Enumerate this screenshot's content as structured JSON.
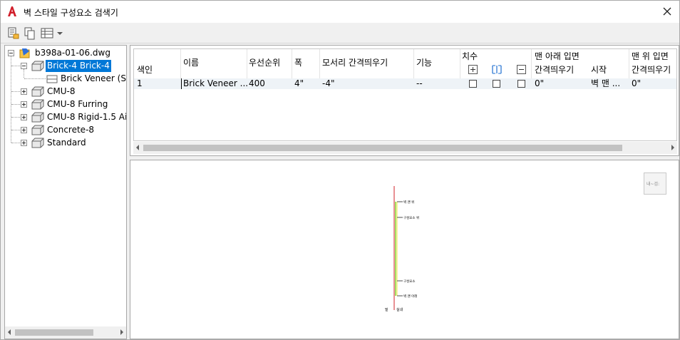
{
  "window": {
    "title": "벽 스타일 구성요소 검색기",
    "app_icon": "autocad-a-icon",
    "close_icon": "close-icon"
  },
  "toolbar": {
    "buttons": [
      {
        "name": "select-objects-button",
        "icon": "document-properties-icon"
      },
      {
        "name": "copy-button",
        "icon": "copy-icon"
      },
      {
        "name": "view-options-button",
        "icon": "table-view-icon"
      }
    ]
  },
  "tree": {
    "root": "b398a-01-06.dwg",
    "items": [
      {
        "label": "Brick-4 Brick-4",
        "expanded": true,
        "selected": true,
        "children": [
          {
            "label": "Brick Veneer (Str"
          }
        ]
      },
      {
        "label": "CMU-8",
        "expanded": false
      },
      {
        "label": "CMU-8 Furring",
        "expanded": false
      },
      {
        "label": "CMU-8 Rigid-1.5 Air",
        "expanded": false
      },
      {
        "label": "Concrete-8",
        "expanded": false
      },
      {
        "label": "Standard",
        "expanded": false
      }
    ]
  },
  "grid": {
    "headers": {
      "index": "색인",
      "name": "이름",
      "priority": "우선순위",
      "width": "폭",
      "edge_offset": "모서리 간격띄우기",
      "function": "기능",
      "dimension": "치수",
      "bottom_elev": "맨 아래 입면",
      "bottom_offset": "간격띄우기",
      "bottom_from": "시작",
      "top_elev": "맨 위 입면",
      "top_offset": "간격띄우기"
    },
    "rows": [
      {
        "index": "1",
        "name": "Brick Veneer ...",
        "priority": "400",
        "width": "4\"",
        "edge_offset": "-4\"",
        "function": "--",
        "bottom_offset": "0\"",
        "bottom_from": "벽 맨 ...",
        "top_offset": "0\""
      }
    ]
  },
  "preview": {
    "view_button_label": "내~검:",
    "labels": {
      "top": "벽 맨 위",
      "upper": "구성요소 위",
      "lower": "구성요소",
      "bottom": "벽 맨 아래",
      "base_left": "밑",
      "base_right": "실내"
    },
    "colors": {
      "red": "#d2202a",
      "green": "#7ed321",
      "yellow": "#f0e040"
    }
  }
}
